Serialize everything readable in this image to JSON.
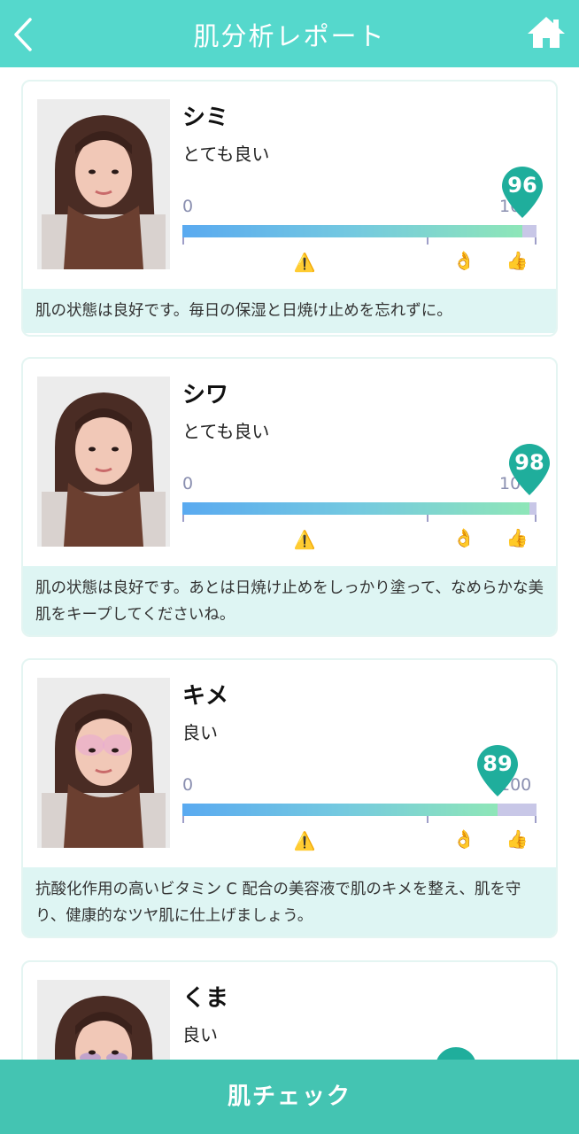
{
  "header": {
    "title": "肌分析レポート",
    "back_icon": "chevron-left-icon",
    "home_icon": "home-icon"
  },
  "colors": {
    "header": "#55d8cc",
    "footer": "#44c4b2",
    "advice_bg": "#def5f3",
    "pin": "#1fae9c"
  },
  "scale": {
    "min": "0",
    "max": "100"
  },
  "cards": [
    {
      "label": "シミ",
      "grade": "とても良い",
      "score": "96",
      "score_value": 96,
      "advice": "肌の状態は良好です。毎日の保湿と日焼け止めを忘れずに。"
    },
    {
      "label": "シワ",
      "grade": "とても良い",
      "score": "98",
      "score_value": 98,
      "advice": "肌の状態は良好です。あとは日焼け止めをしっかり塗って、なめらかな美肌をキープしてくださいね。"
    },
    {
      "label": "キメ",
      "grade": "良い",
      "score": "89",
      "score_value": 89,
      "advice": "抗酸化作用の高いビタミン C 配合の美容液で肌のキメを整え、肌を守り、健康的なツヤ肌に仕上げましょう。"
    },
    {
      "label": "くま",
      "grade": "良い",
      "score": "",
      "score_value": null,
      "advice": ""
    }
  ],
  "icons": {
    "warning": "warning-icon",
    "ok": "ok-hand-icon",
    "good": "thumbs-up-icon"
  },
  "footer": {
    "button_label": "肌チェック"
  }
}
